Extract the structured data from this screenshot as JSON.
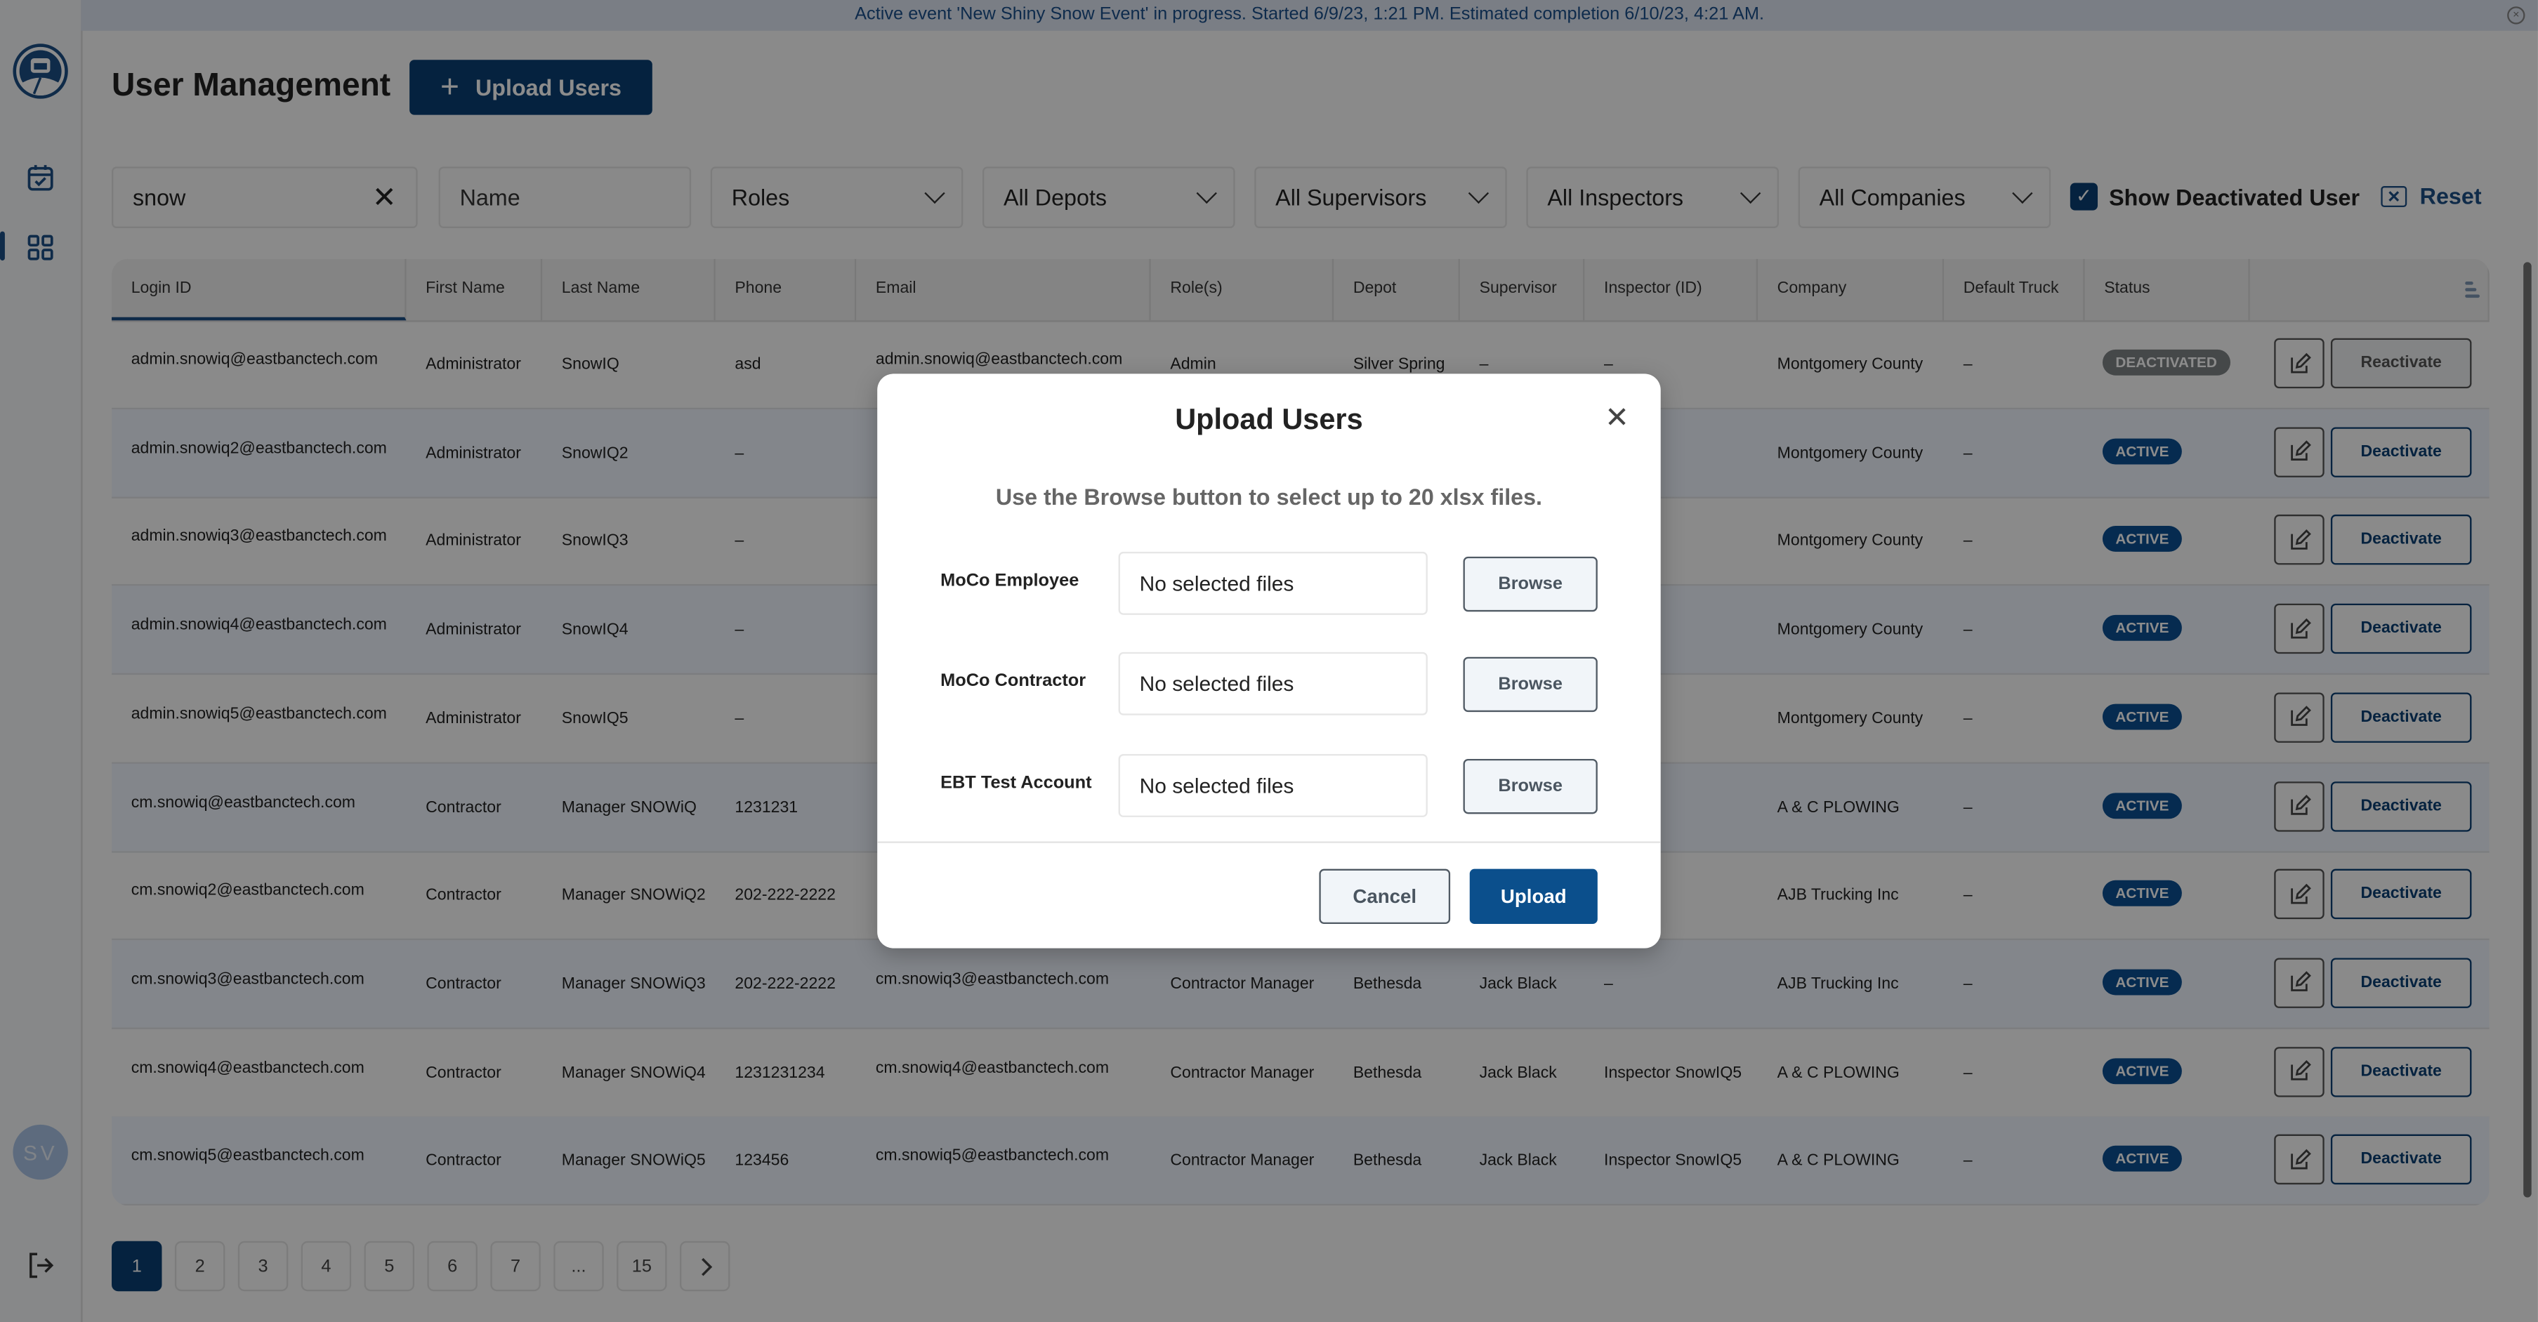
{
  "banner": {
    "text": "Active event 'New Shiny Snow Event' in progress. Started 6/9/23, 1:21 PM. Estimated completion 6/10/23, 4:21 AM.",
    "close_icon": "close-circle-icon"
  },
  "sidebar": {
    "avatar_initials": "SV",
    "items": [
      {
        "icon": "calendar-check-icon"
      },
      {
        "icon": "grid-icon",
        "active": true
      }
    ],
    "logout_icon": "logout-icon"
  },
  "header": {
    "title": "User Management",
    "upload_label": "Upload Users"
  },
  "filters": {
    "search_value": "snow",
    "name_placeholder": "Name",
    "roles": "Roles",
    "depots": "All Depots",
    "supervisors": "All Supervisors",
    "inspectors": "All Inspectors",
    "companies": "All Companies",
    "show_deactivated_label": "Show Deactivated User",
    "show_deactivated_checked": true,
    "reset_label": "Reset"
  },
  "table": {
    "columns": [
      "Login ID",
      "First Name",
      "Last Name",
      "Phone",
      "Email",
      "Role(s)",
      "Depot",
      "Supervisor",
      "Inspector (ID)",
      "Company",
      "Default Truck",
      "Status",
      ""
    ],
    "rows": [
      {
        "login": "admin.snowiq@eastbanctech.com",
        "first": "Administrator",
        "last": "SnowIQ",
        "phone": "asd",
        "email": "admin.snowiq@eastbanctech.com",
        "role": "Admin",
        "depot": "Silver Spring",
        "supervisor": "–",
        "inspector": "–",
        "company": "Montgomery County",
        "truck": "–",
        "status": "DEACTIVATED",
        "action": "Reactivate"
      },
      {
        "login": "admin.snowiq2@eastbanctech.com",
        "first": "Administrator",
        "last": "SnowIQ2",
        "phone": "–",
        "company": "Montgomery County",
        "truck": "–",
        "status": "ACTIVE",
        "action": "Deactivate"
      },
      {
        "login": "admin.snowiq3@eastbanctech.com",
        "first": "Administrator",
        "last": "SnowIQ3",
        "phone": "–",
        "company": "Montgomery County",
        "truck": "–",
        "status": "ACTIVE",
        "action": "Deactivate"
      },
      {
        "login": "admin.snowiq4@eastbanctech.com",
        "first": "Administrator",
        "last": "SnowIQ4",
        "phone": "–",
        "company": "Montgomery County",
        "truck": "–",
        "status": "ACTIVE",
        "action": "Deactivate"
      },
      {
        "login": "admin.snowiq5@eastbanctech.com",
        "first": "Administrator",
        "last": "SnowIQ5",
        "phone": "–",
        "company": "Montgomery County",
        "truck": "–",
        "status": "ACTIVE",
        "action": "Deactivate"
      },
      {
        "login": "cm.snowiq@eastbanctech.com",
        "first": "Contractor",
        "last": "Manager SNOWiQ",
        "phone": "1231231",
        "company": "A & C PLOWING",
        "truck": "–",
        "status": "ACTIVE",
        "action": "Deactivate"
      },
      {
        "login": "cm.snowiq2@eastbanctech.com",
        "first": "Contractor",
        "last": "Manager SNOWiQ2",
        "phone": "202-222-2222",
        "company": "AJB Trucking Inc",
        "truck": "–",
        "status": "ACTIVE",
        "action": "Deactivate"
      },
      {
        "login": "cm.snowiq3@eastbanctech.com",
        "first": "Contractor",
        "last": "Manager SNOWiQ3",
        "phone": "202-222-2222",
        "email": "cm.snowiq3@eastbanctech.com",
        "role": "Contractor Manager",
        "depot": "Bethesda",
        "supervisor": "Jack Black",
        "inspector": "–",
        "company": "AJB Trucking Inc",
        "truck": "–",
        "status": "ACTIVE",
        "action": "Deactivate"
      },
      {
        "login": "cm.snowiq4@eastbanctech.com",
        "first": "Contractor",
        "last": "Manager SNOWiQ4",
        "phone": "1231231234",
        "email": "cm.snowiq4@eastbanctech.com",
        "role": "Contractor Manager",
        "depot": "Bethesda",
        "supervisor": "Jack Black",
        "inspector": "Inspector SnowIQ5",
        "company": "A & C PLOWING",
        "truck": "–",
        "status": "ACTIVE",
        "action": "Deactivate"
      },
      {
        "login": "cm.snowiq5@eastbanctech.com",
        "first": "Contractor",
        "last": "Manager SNOWiQ5",
        "phone": "123456",
        "email": "cm.snowiq5@eastbanctech.com",
        "role": "Contractor Manager",
        "depot": "Bethesda",
        "supervisor": "Jack Black",
        "inspector": "Inspector SnowIQ5",
        "company": "A & C PLOWING",
        "truck": "–",
        "status": "ACTIVE",
        "action": "Deactivate"
      }
    ]
  },
  "pagination": {
    "pages": [
      "1",
      "2",
      "3",
      "4",
      "5",
      "6",
      "7",
      "...",
      "15"
    ],
    "current": "1",
    "next_icon": "chevron-right-icon"
  },
  "modal": {
    "title": "Upload Users",
    "subtitle": "Use the Browse button to select up to 20 xlsx files.",
    "fields": [
      {
        "label": "MoCo Employee",
        "value": "No selected files",
        "button": "Browse"
      },
      {
        "label": "MoCo Contractor",
        "value": "No selected files",
        "button": "Browse"
      },
      {
        "label": "EBT Test Account",
        "value": "No selected files",
        "button": "Browse"
      }
    ],
    "cancel_label": "Cancel",
    "upload_label": "Upload"
  },
  "colors": {
    "primary": "#0a3f73",
    "active_badge": "#0b4f92",
    "deactivated_badge": "#7f8386",
    "banner_text": "#1b4f8a"
  }
}
